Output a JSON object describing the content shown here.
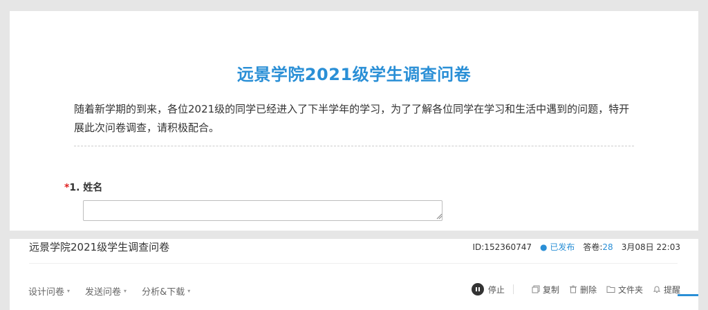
{
  "survey": {
    "title": "远景学院2021级学生调查问卷",
    "intro": "随着新学期的到来，各位2021级的同学已经进入了下半学年的学习，为了了解各位同学在学习和生活中遇到的问题，特开展此次问卷调查，请积极配合。",
    "question1": {
      "required_mark": "*",
      "label": "1. 姓名",
      "value": ""
    }
  },
  "admin": {
    "title": "远景学院2021级学生调查问卷",
    "id_text": "ID:152360747",
    "status_dot": "●",
    "status": "已发布",
    "responses_label": "答卷:",
    "responses_count": "28",
    "date": "3月08日 22:03",
    "tabs": [
      {
        "label": "设计问卷",
        "caret": "▾"
      },
      {
        "label": "发送问卷",
        "caret": "▾"
      },
      {
        "label": "分析&下载",
        "caret": "▾"
      }
    ],
    "actions": {
      "stop": "停止",
      "copy": "复制",
      "delete": "删除",
      "folder": "文件夹",
      "remind": "提醒"
    }
  },
  "colors": {
    "accent": "#2a8fd6",
    "required": "#e02020",
    "background": "#e6e6e6"
  }
}
